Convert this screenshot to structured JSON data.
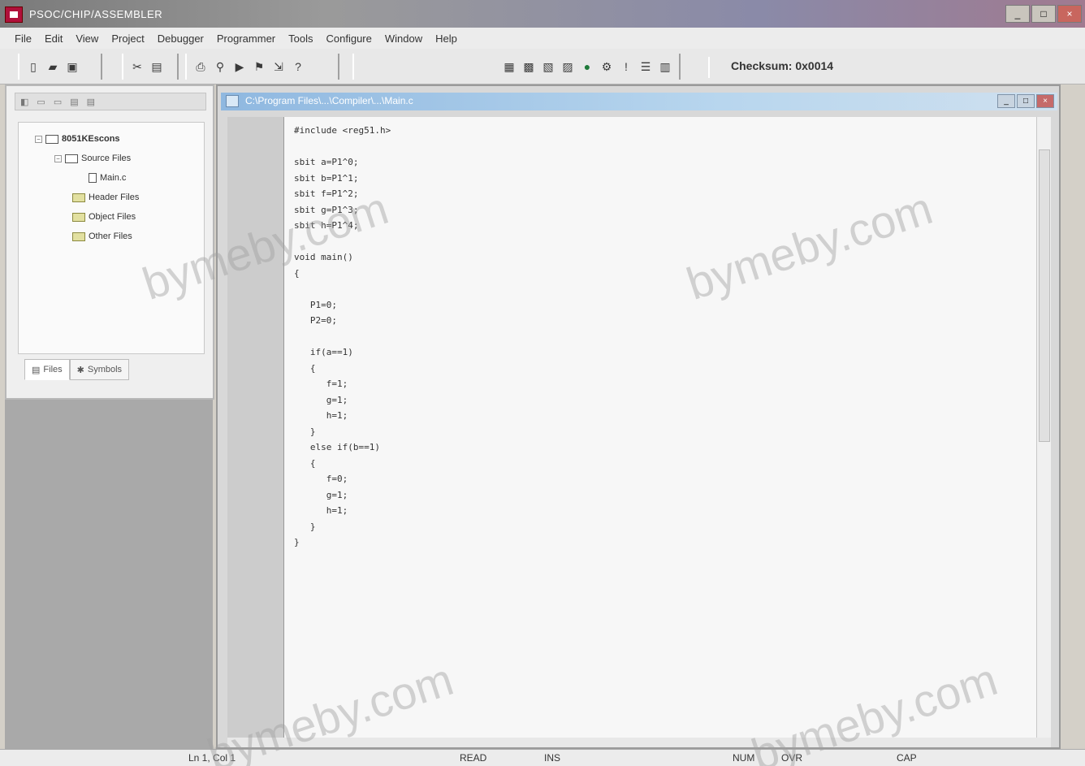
{
  "window": {
    "title": "PSOC/CHIP/ASSEMBLER",
    "minimize": "_",
    "maximize": "□",
    "close": "×"
  },
  "menu": [
    "File",
    "Edit",
    "View",
    "Project",
    "Debugger",
    "Programmer",
    "Tools",
    "Configure",
    "Window",
    "Help"
  ],
  "toolbar": {
    "checksum_label": "Checksum:",
    "checksum_value": "0x0014"
  },
  "workspace": {
    "tree": [
      {
        "label": "8051KEscons",
        "level": 0,
        "kind": "project"
      },
      {
        "label": "Source Files",
        "level": 1,
        "kind": "folder-open"
      },
      {
        "label": "Main.c",
        "level": 2,
        "kind": "file"
      },
      {
        "label": "Header Files",
        "level": 1,
        "kind": "folder"
      },
      {
        "label": "Object Files",
        "level": 1,
        "kind": "folder"
      },
      {
        "label": "Other Files",
        "level": 1,
        "kind": "folder"
      }
    ],
    "tabs": [
      {
        "label": "Files",
        "icon": "files-icon"
      },
      {
        "label": "Symbols",
        "icon": "symbols-icon"
      }
    ]
  },
  "editor": {
    "title": "C:\\Program Files\\...\\Compiler\\...\\Main.c",
    "code_lines": [
      "#include <reg51.h>",
      "",
      "sbit a=P1^0;",
      "sbit b=P1^1;",
      "sbit f=P1^2;",
      "sbit g=P1^3;",
      "sbit h=P1^4;",
      "",
      "void main()",
      "{",
      "",
      "   P1=0;",
      "   P2=0;",
      "",
      "   if(a==1)",
      "   {",
      "      f=1;",
      "      g=1;",
      "      h=1;",
      "   }",
      "   else if(b==1)",
      "   {",
      "      f=0;",
      "      g=1;",
      "      h=1;",
      "   }",
      "}"
    ]
  },
  "status": {
    "left": "Ln 1, Col 1",
    "read": "READ",
    "ins": "INS",
    "pos": "NUM",
    "ovr": "OVR",
    "cap": "CAP"
  },
  "watermarks": [
    "bymeby.com",
    "bymeby.com",
    "bymeby.com",
    "bymeby.com"
  ]
}
